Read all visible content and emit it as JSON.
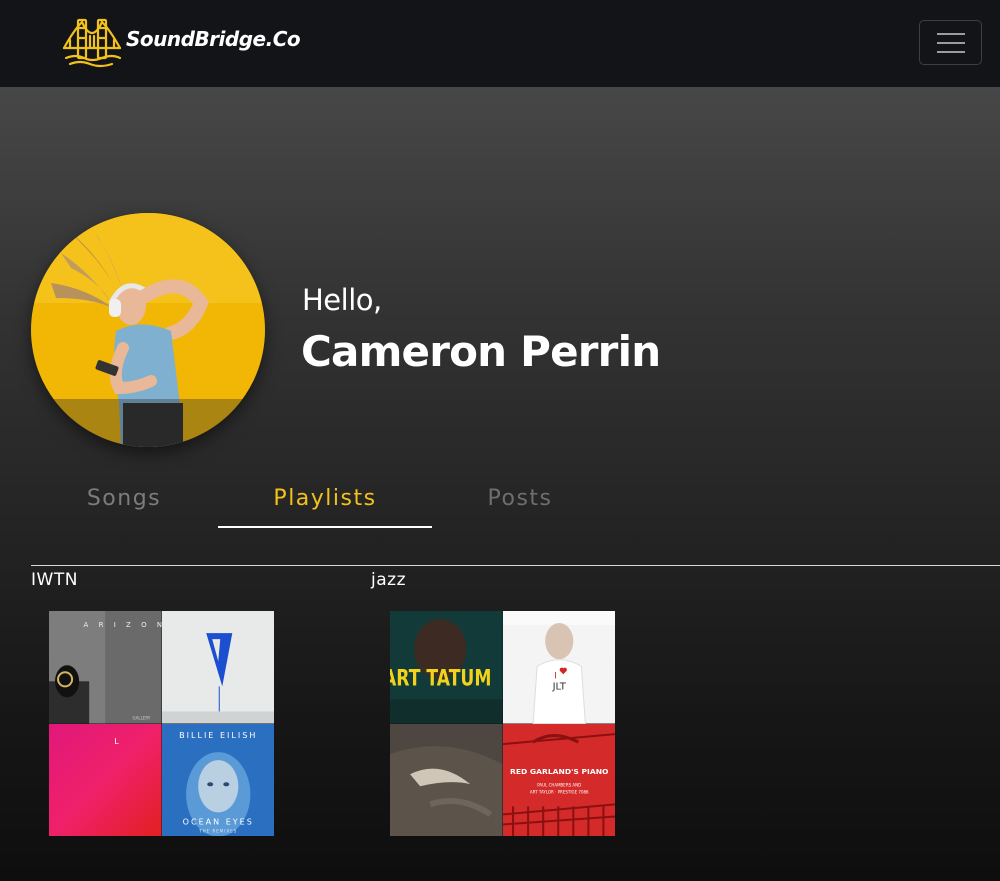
{
  "navbar": {
    "brand_name": "SoundBridge.Co",
    "logo_icon": "golden-gate-bridge-icon",
    "menu_icon": "hamburger-menu-icon",
    "brand_color": "#f2c21a"
  },
  "profile": {
    "greeting": "Hello,",
    "name": "Cameron Perrin",
    "avatar": "woman-dancing-with-headphones-photo"
  },
  "tabs": [
    {
      "label": "Songs",
      "active": false
    },
    {
      "label": "Playlists",
      "active": true
    },
    {
      "label": "Posts",
      "active": false
    }
  ],
  "playlists": [
    {
      "title": "IWTN",
      "covers": [
        {
          "art": "arizona-album-cover",
          "text": "A R I Z O N A"
        },
        {
          "art": "blue-abstract-cover"
        },
        {
          "art": "pink-red-gradient-cover"
        },
        {
          "art": "billie-eilish-ocean-eyes-cover",
          "text_top": "BILLIE EILISH",
          "text_bottom": "OCEAN EYES",
          "text_sub": "THE REMIXES"
        }
      ]
    },
    {
      "title": "jazz",
      "covers": [
        {
          "art": "art-tatum-album-cover",
          "text": "ART TATUM"
        },
        {
          "art": "i-love-jlt-cover",
          "text": "JLT"
        },
        {
          "art": "underwater-swimmer-cover"
        },
        {
          "art": "red-garlands-piano-cover",
          "text": "RED GARLAND'S PIANO"
        }
      ]
    }
  ]
}
